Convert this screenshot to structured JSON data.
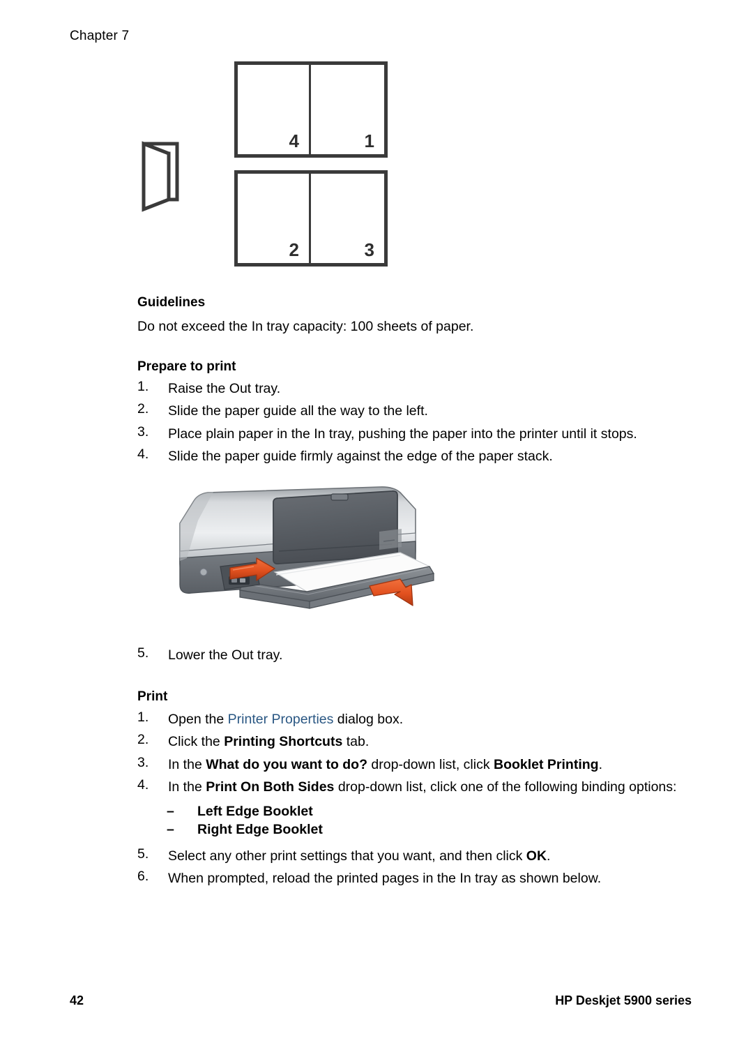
{
  "document": {
    "chapter_label": "Chapter 7"
  },
  "booklet_figure": {
    "fold_icon_name": "folded-booklet-icon",
    "sheet_rows": [
      {
        "left_number": "4",
        "right_number": "1"
      },
      {
        "left_number": "2",
        "right_number": "3"
      }
    ]
  },
  "guidelines": {
    "heading": "Guidelines",
    "text": "Do not exceed the In tray capacity: 100 sheets of paper."
  },
  "prepare_to_print": {
    "heading": "Prepare to print",
    "steps": [
      {
        "number": "1.",
        "text": "Raise the Out tray."
      },
      {
        "number": "2.",
        "text": "Slide the paper guide all the way to the left."
      },
      {
        "number": "3.",
        "text": "Place plain paper in the In tray, pushing the paper into the printer until it stops."
      },
      {
        "number": "4.",
        "text": "Slide the paper guide firmly against the edge of the paper stack."
      }
    ],
    "step_after_figure": {
      "number": "5.",
      "text": "Lower the Out tray."
    }
  },
  "printer_illustration": {
    "name": "hp-deskjet-printer-illustration",
    "arrow_color": "#E2511F",
    "body_color": "#C9CCCF",
    "cover_color": "#585C61"
  },
  "print_section": {
    "heading": "Print",
    "steps": [
      {
        "number": "1.",
        "prefix": "Open the ",
        "link": "Printer Properties",
        "suffix": " dialog box."
      },
      {
        "number": "2.",
        "prefix": "Click the ",
        "bold": "Printing Shortcuts",
        "suffix": " tab."
      },
      {
        "number": "3.",
        "prefix": "In the ",
        "bold": "What do you want to do?",
        "middle": " drop-down list, click ",
        "bold2": "Booklet Printing",
        "suffix": "."
      },
      {
        "number": "4.",
        "prefix": "In the ",
        "bold": "Print On Both Sides",
        "suffix": " drop-down list, click one of the following binding options:"
      },
      {
        "number": "5.",
        "prefix": "Select any other print settings that you want, and then click ",
        "bold": "OK",
        "suffix": "."
      },
      {
        "number": "6.",
        "prefix": "When prompted, reload the printed pages in the In tray as shown below."
      }
    ],
    "binding_options": [
      {
        "dash": "–",
        "label": "Left Edge Booklet"
      },
      {
        "dash": "–",
        "label": "Right Edge Booklet"
      }
    ]
  },
  "footer": {
    "page_number": "42",
    "product": "HP Deskjet 5900 series"
  },
  "colors": {
    "link": "#2a5783",
    "figure_stroke": "#3a3a3a",
    "text": "#000000"
  }
}
